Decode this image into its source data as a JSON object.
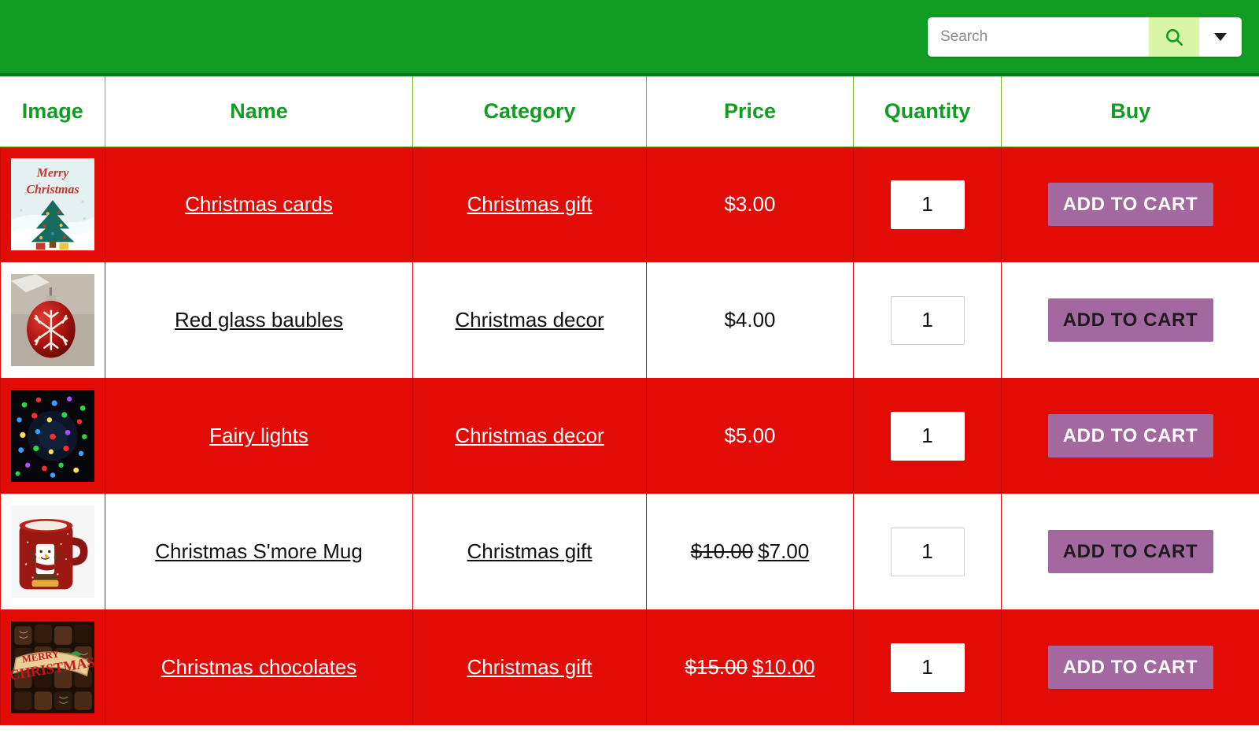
{
  "navbar": {
    "background_color": "#119c24",
    "search": {
      "placeholder": "Search",
      "value": "",
      "search_icon": "search-icon",
      "dropdown_icon": "chevron-down-icon"
    }
  },
  "table": {
    "headers": [
      {
        "label": "Image"
      },
      {
        "label": "Name"
      },
      {
        "label": "Category"
      },
      {
        "label": "Price"
      },
      {
        "label": "Quantity"
      },
      {
        "label": "Buy"
      }
    ],
    "header_color": "#129c24",
    "row_alt_color": "#e30b06",
    "cart_button_color": "#a3689f",
    "rows": [
      {
        "image_alt": "christmas-cards-thumbnail",
        "name": "Christmas cards",
        "category": "Christmas gift",
        "price": "$3.00",
        "price_old": "",
        "price_new": "",
        "quantity": "1",
        "buy_label": "ADD TO CART",
        "highlighted": true
      },
      {
        "image_alt": "red-glass-baubles-thumbnail",
        "name": "Red glass baubles",
        "category": "Christmas decor",
        "price": "$4.00",
        "price_old": "",
        "price_new": "",
        "quantity": "1",
        "buy_label": "ADD TO CART",
        "highlighted": false
      },
      {
        "image_alt": "fairy-lights-thumbnail",
        "name": "Fairy lights",
        "category": "Christmas decor",
        "price": "$5.00",
        "price_old": "",
        "price_new": "",
        "quantity": "1",
        "buy_label": "ADD TO CART",
        "highlighted": true
      },
      {
        "image_alt": "christmas-smore-mug-thumbnail",
        "name": "Christmas S'more Mug",
        "category": "Christmas gift",
        "price": "",
        "price_old": "$10.00",
        "price_new": "$7.00",
        "quantity": "1",
        "buy_label": "ADD TO CART",
        "highlighted": false
      },
      {
        "image_alt": "christmas-chocolates-thumbnail",
        "name": "Christmas chocolates",
        "category": "Christmas gift",
        "price": "",
        "price_old": "$15.00",
        "price_new": "$10.00",
        "quantity": "1",
        "buy_label": "ADD TO CART",
        "highlighted": true
      }
    ]
  }
}
